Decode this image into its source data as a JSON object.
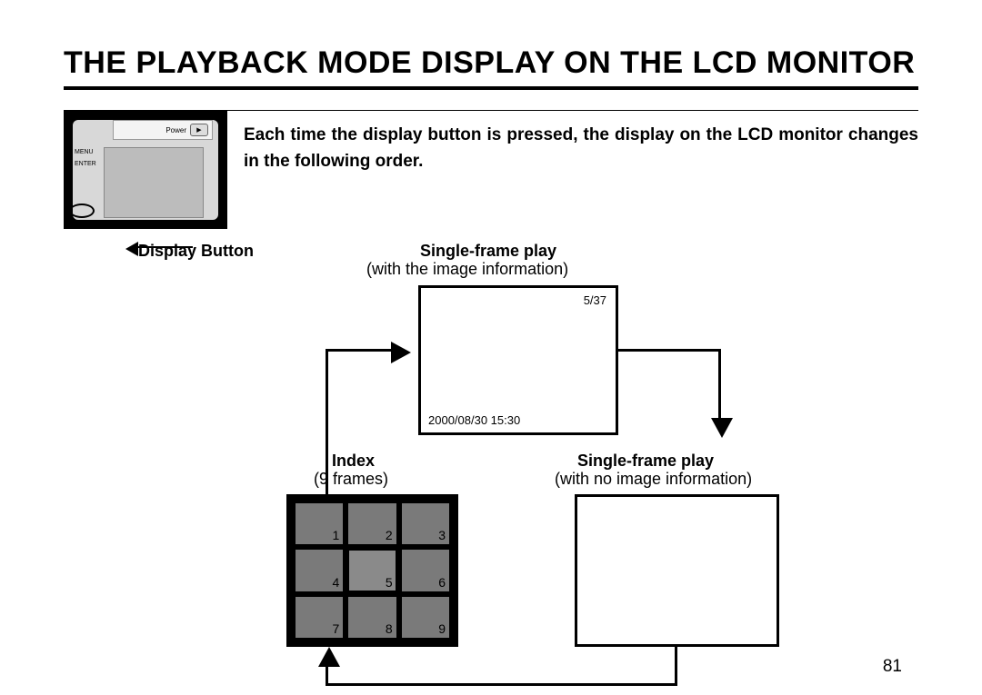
{
  "title": "THE PLAYBACK MODE DISPLAY ON THE LCD MONITOR",
  "intro": "Each time the display button is pressed, the display on the LCD monitor changes in the following order.",
  "camera": {
    "power_label": "Power",
    "side_labels": [
      "",
      "MENU",
      "ENTER"
    ]
  },
  "display_button_label": "Display Button",
  "single_info": {
    "title": "Single-frame play",
    "subtitle": "(with the image information)",
    "counter": "5/37",
    "datetime": "2000/08/30 15:30"
  },
  "single_noinfo": {
    "title": "Single-frame play",
    "subtitle": "(with no image information)"
  },
  "index": {
    "title": "Index",
    "subtitle": "(9 frames)",
    "cells": [
      "1",
      "2",
      "3",
      "4",
      "5",
      "6",
      "7",
      "8",
      "9"
    ],
    "selected": 5
  },
  "page_number": "81"
}
